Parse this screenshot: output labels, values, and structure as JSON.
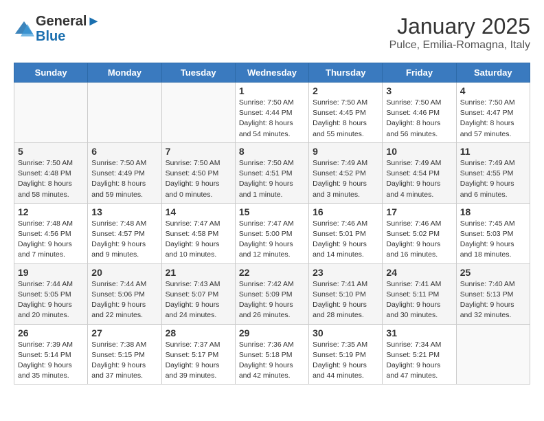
{
  "header": {
    "logo_line1": "General",
    "logo_line2": "Blue",
    "month": "January 2025",
    "location": "Pulce, Emilia-Romagna, Italy"
  },
  "weekdays": [
    "Sunday",
    "Monday",
    "Tuesday",
    "Wednesday",
    "Thursday",
    "Friday",
    "Saturday"
  ],
  "weeks": [
    [
      {
        "day": "",
        "info": ""
      },
      {
        "day": "",
        "info": ""
      },
      {
        "day": "",
        "info": ""
      },
      {
        "day": "1",
        "info": "Sunrise: 7:50 AM\nSunset: 4:44 PM\nDaylight: 8 hours\nand 54 minutes."
      },
      {
        "day": "2",
        "info": "Sunrise: 7:50 AM\nSunset: 4:45 PM\nDaylight: 8 hours\nand 55 minutes."
      },
      {
        "day": "3",
        "info": "Sunrise: 7:50 AM\nSunset: 4:46 PM\nDaylight: 8 hours\nand 56 minutes."
      },
      {
        "day": "4",
        "info": "Sunrise: 7:50 AM\nSunset: 4:47 PM\nDaylight: 8 hours\nand 57 minutes."
      }
    ],
    [
      {
        "day": "5",
        "info": "Sunrise: 7:50 AM\nSunset: 4:48 PM\nDaylight: 8 hours\nand 58 minutes."
      },
      {
        "day": "6",
        "info": "Sunrise: 7:50 AM\nSunset: 4:49 PM\nDaylight: 8 hours\nand 59 minutes."
      },
      {
        "day": "7",
        "info": "Sunrise: 7:50 AM\nSunset: 4:50 PM\nDaylight: 9 hours\nand 0 minutes."
      },
      {
        "day": "8",
        "info": "Sunrise: 7:50 AM\nSunset: 4:51 PM\nDaylight: 9 hours\nand 1 minute."
      },
      {
        "day": "9",
        "info": "Sunrise: 7:49 AM\nSunset: 4:52 PM\nDaylight: 9 hours\nand 3 minutes."
      },
      {
        "day": "10",
        "info": "Sunrise: 7:49 AM\nSunset: 4:54 PM\nDaylight: 9 hours\nand 4 minutes."
      },
      {
        "day": "11",
        "info": "Sunrise: 7:49 AM\nSunset: 4:55 PM\nDaylight: 9 hours\nand 6 minutes."
      }
    ],
    [
      {
        "day": "12",
        "info": "Sunrise: 7:48 AM\nSunset: 4:56 PM\nDaylight: 9 hours\nand 7 minutes."
      },
      {
        "day": "13",
        "info": "Sunrise: 7:48 AM\nSunset: 4:57 PM\nDaylight: 9 hours\nand 9 minutes."
      },
      {
        "day": "14",
        "info": "Sunrise: 7:47 AM\nSunset: 4:58 PM\nDaylight: 9 hours\nand 10 minutes."
      },
      {
        "day": "15",
        "info": "Sunrise: 7:47 AM\nSunset: 5:00 PM\nDaylight: 9 hours\nand 12 minutes."
      },
      {
        "day": "16",
        "info": "Sunrise: 7:46 AM\nSunset: 5:01 PM\nDaylight: 9 hours\nand 14 minutes."
      },
      {
        "day": "17",
        "info": "Sunrise: 7:46 AM\nSunset: 5:02 PM\nDaylight: 9 hours\nand 16 minutes."
      },
      {
        "day": "18",
        "info": "Sunrise: 7:45 AM\nSunset: 5:03 PM\nDaylight: 9 hours\nand 18 minutes."
      }
    ],
    [
      {
        "day": "19",
        "info": "Sunrise: 7:44 AM\nSunset: 5:05 PM\nDaylight: 9 hours\nand 20 minutes."
      },
      {
        "day": "20",
        "info": "Sunrise: 7:44 AM\nSunset: 5:06 PM\nDaylight: 9 hours\nand 22 minutes."
      },
      {
        "day": "21",
        "info": "Sunrise: 7:43 AM\nSunset: 5:07 PM\nDaylight: 9 hours\nand 24 minutes."
      },
      {
        "day": "22",
        "info": "Sunrise: 7:42 AM\nSunset: 5:09 PM\nDaylight: 9 hours\nand 26 minutes."
      },
      {
        "day": "23",
        "info": "Sunrise: 7:41 AM\nSunset: 5:10 PM\nDaylight: 9 hours\nand 28 minutes."
      },
      {
        "day": "24",
        "info": "Sunrise: 7:41 AM\nSunset: 5:11 PM\nDaylight: 9 hours\nand 30 minutes."
      },
      {
        "day": "25",
        "info": "Sunrise: 7:40 AM\nSunset: 5:13 PM\nDaylight: 9 hours\nand 32 minutes."
      }
    ],
    [
      {
        "day": "26",
        "info": "Sunrise: 7:39 AM\nSunset: 5:14 PM\nDaylight: 9 hours\nand 35 minutes."
      },
      {
        "day": "27",
        "info": "Sunrise: 7:38 AM\nSunset: 5:15 PM\nDaylight: 9 hours\nand 37 minutes."
      },
      {
        "day": "28",
        "info": "Sunrise: 7:37 AM\nSunset: 5:17 PM\nDaylight: 9 hours\nand 39 minutes."
      },
      {
        "day": "29",
        "info": "Sunrise: 7:36 AM\nSunset: 5:18 PM\nDaylight: 9 hours\nand 42 minutes."
      },
      {
        "day": "30",
        "info": "Sunrise: 7:35 AM\nSunset: 5:19 PM\nDaylight: 9 hours\nand 44 minutes."
      },
      {
        "day": "31",
        "info": "Sunrise: 7:34 AM\nSunset: 5:21 PM\nDaylight: 9 hours\nand 47 minutes."
      },
      {
        "day": "",
        "info": ""
      }
    ]
  ]
}
